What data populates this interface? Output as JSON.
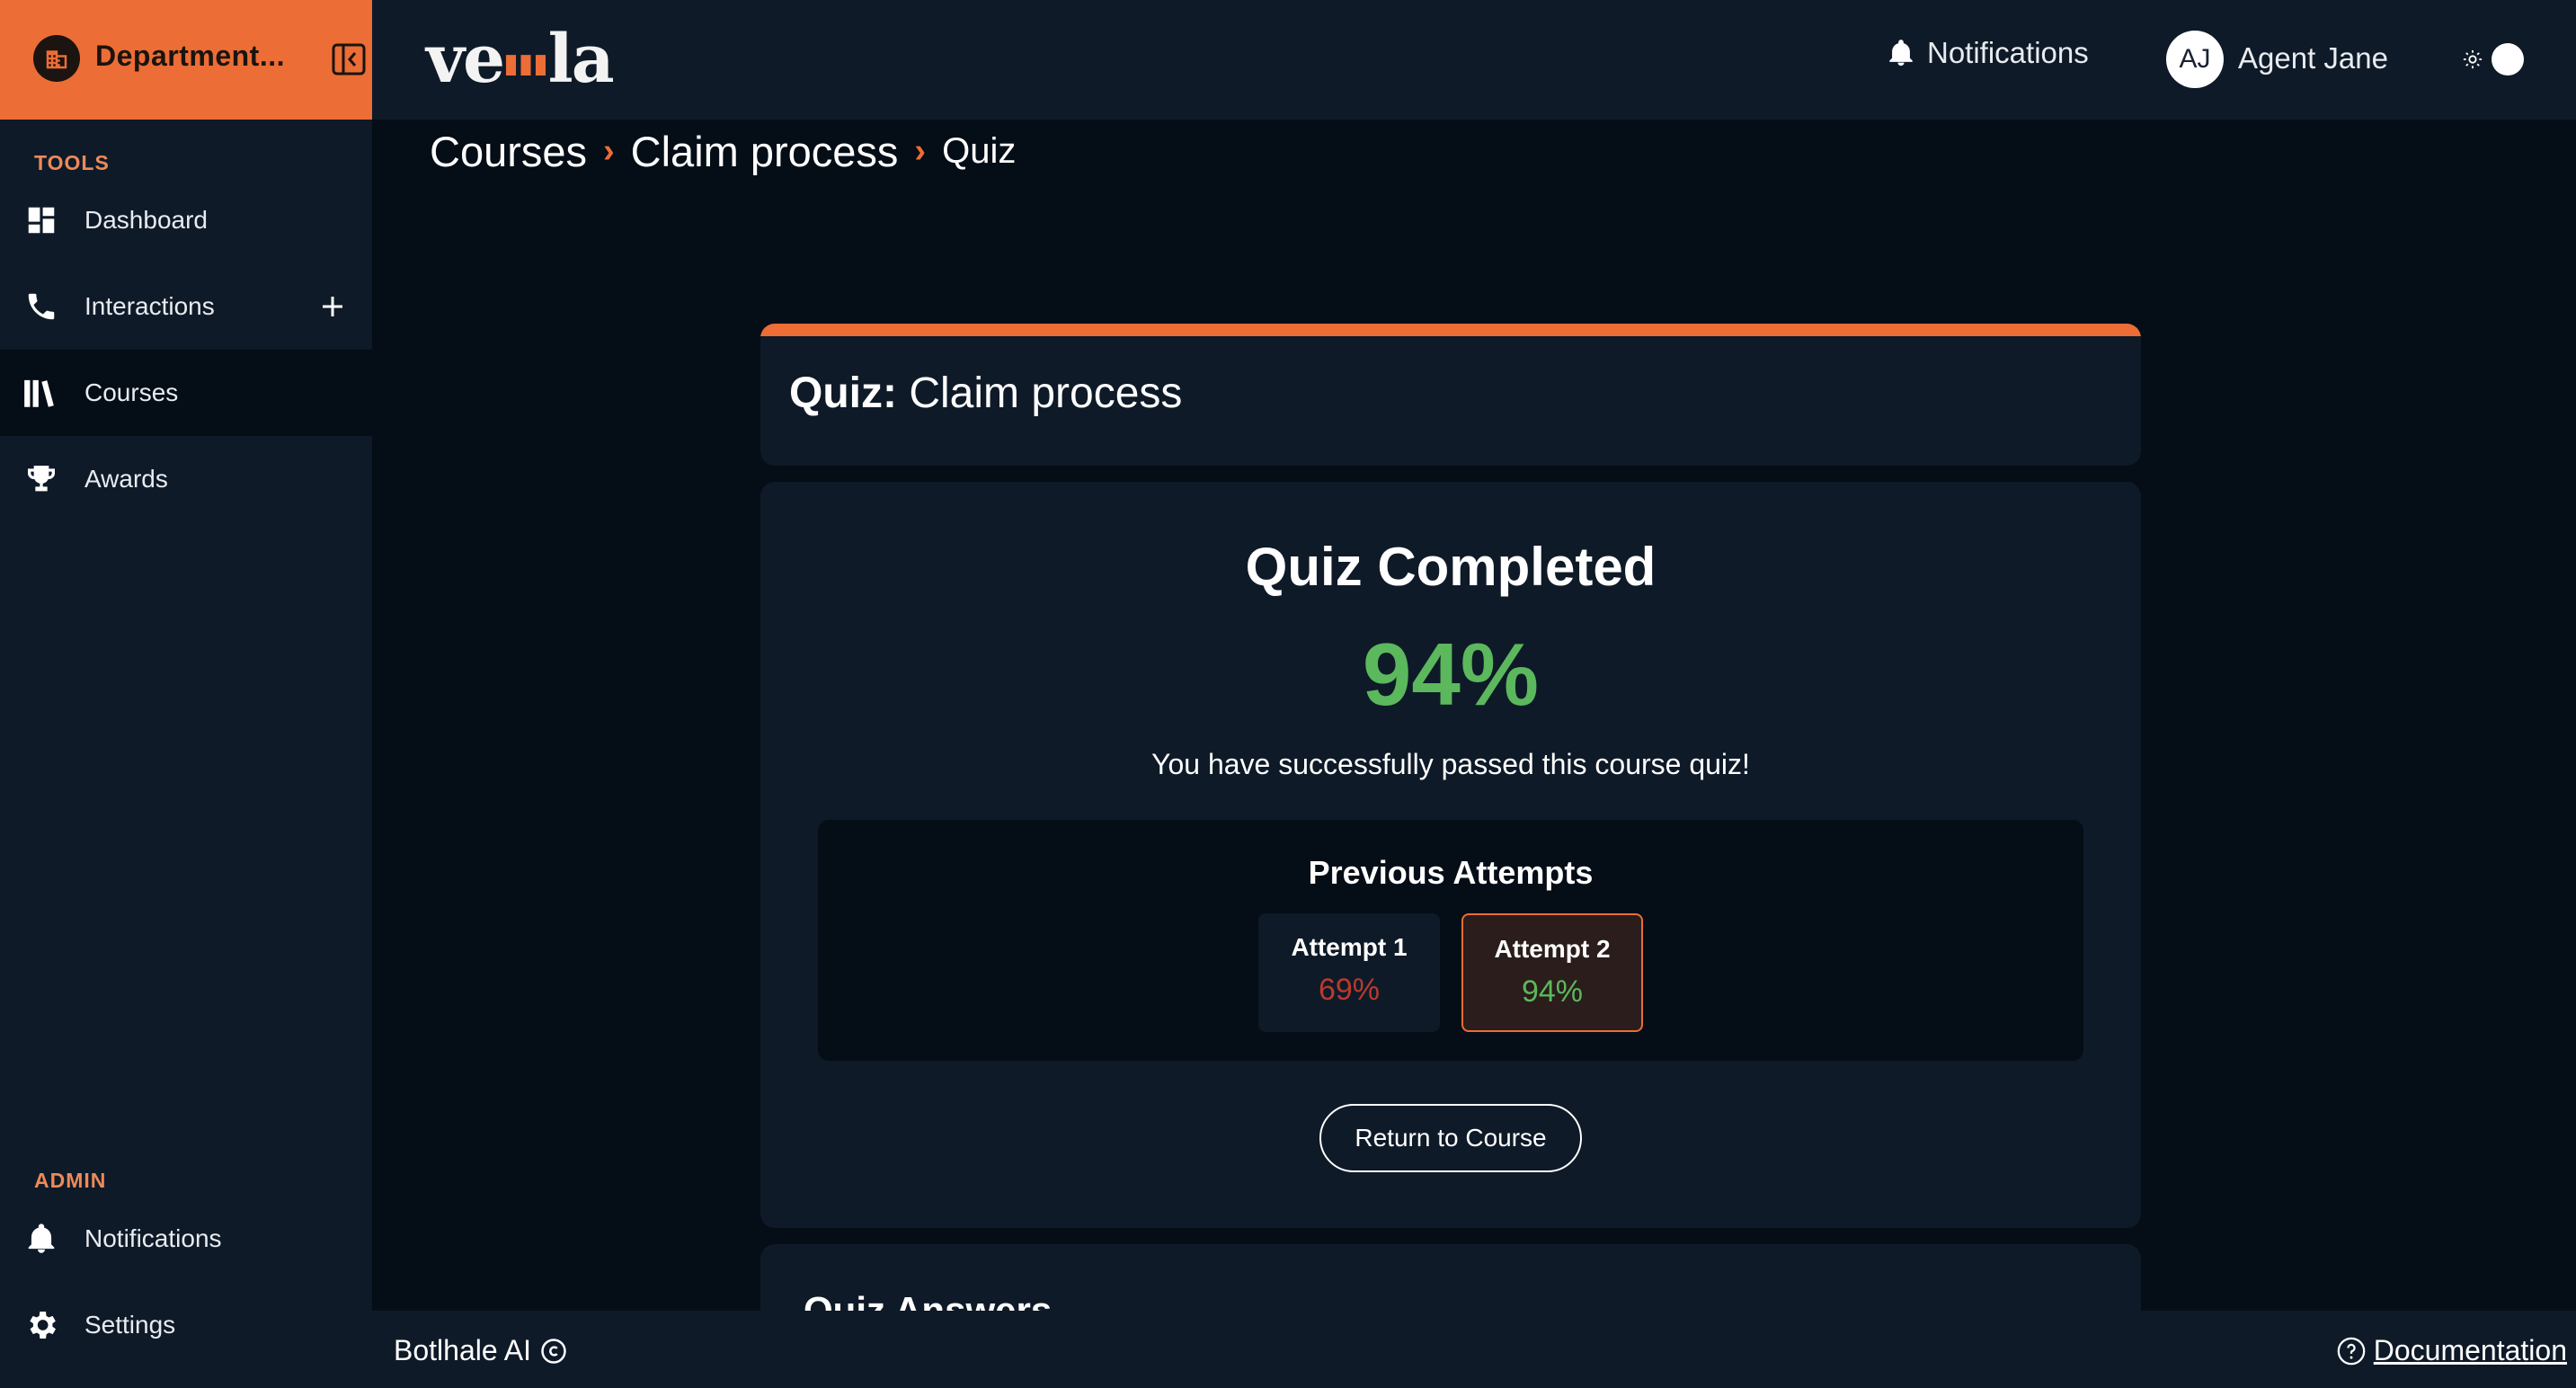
{
  "sidebar": {
    "department": "Department...",
    "tools_label": "TOOLS",
    "admin_label": "ADMIN",
    "tools": [
      {
        "label": "Dashboard",
        "icon": "dashboard-icon"
      },
      {
        "label": "Interactions",
        "icon": "phone-icon"
      },
      {
        "label": "Courses",
        "icon": "books-icon"
      },
      {
        "label": "Awards",
        "icon": "trophy-icon"
      }
    ],
    "admin": [
      {
        "label": "Notifications",
        "icon": "bell-icon"
      },
      {
        "label": "Settings",
        "icon": "gear-icon"
      }
    ]
  },
  "topbar": {
    "logo": "ve  la",
    "notifications_label": "Notifications",
    "user_initials": "AJ",
    "user_name": "Agent Jane"
  },
  "breadcrumb": [
    "Courses",
    "Claim process",
    "Quiz"
  ],
  "quiz": {
    "header_prefix": "Quiz:",
    "header_name": "Claim process",
    "result_title": "Quiz Completed",
    "score": "94%",
    "message": "You have successfully passed this course quiz!",
    "attempts_title": "Previous Attempts",
    "attempts": [
      {
        "label": "Attempt 1",
        "score": "69%",
        "color": "#b83a2e"
      },
      {
        "label": "Attempt 2",
        "score": "94%",
        "color": "#5bb85c"
      }
    ],
    "return_label": "Return to Course",
    "answers_title": "Quiz Answers"
  },
  "footer": {
    "brand": "Botlhale AI",
    "documentation": "Documentation"
  },
  "colors": {
    "accent": "#ec6d35",
    "pass": "#5bb85c",
    "fail": "#b83a2e",
    "panel": "#0f1a28",
    "background": "#050d16"
  }
}
